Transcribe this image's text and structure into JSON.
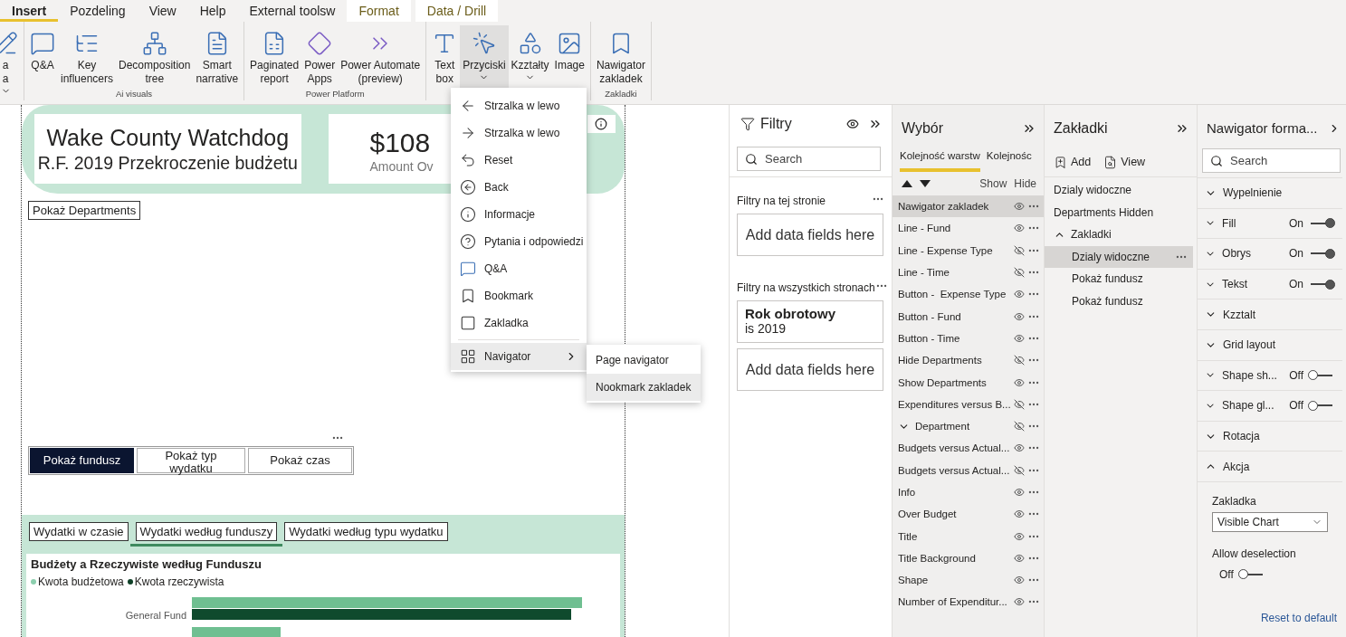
{
  "ribbon_tabs": [
    {
      "label": "Insert",
      "selected": true,
      "kind": "normal"
    },
    {
      "label": "Pozdeling",
      "selected": false,
      "kind": "normal"
    },
    {
      "label": "View",
      "selected": false,
      "kind": "normal"
    },
    {
      "label": "Help",
      "selected": false,
      "kind": "normal"
    },
    {
      "label": "External toolsw",
      "selected": false,
      "kind": "normal"
    },
    {
      "label": "Format",
      "selected": false,
      "kind": "contextual"
    },
    {
      "label": "Data / Drill",
      "selected": false,
      "kind": "contextual"
    }
  ],
  "ribbon_groups": [
    {
      "items": [
        {
          "lines": [
            "a",
            "a"
          ],
          "dropdown": true,
          "selected": false
        }
      ]
    },
    {
      "label": "Ai visuals",
      "items": [
        {
          "lines": [
            "Q&A"
          ],
          "dropdown": false,
          "selected": false
        },
        {
          "lines": [
            "Key",
            "influencers"
          ],
          "dropdown": false,
          "selected": false
        },
        {
          "lines": [
            "Decomposition",
            "tree"
          ],
          "dropdown": false,
          "selected": false
        },
        {
          "lines": [
            "Smart",
            "narrative"
          ],
          "dropdown": false,
          "selected": false
        }
      ]
    },
    {
      "label": "Power Platform",
      "items": [
        {
          "lines": [
            "Paginated",
            "report"
          ],
          "dropdown": false,
          "selected": false
        },
        {
          "lines": [
            "Power",
            "Apps"
          ],
          "dropdown": false,
          "selected": false
        },
        {
          "lines": [
            "Power Automate",
            "(preview)"
          ],
          "dropdown": false,
          "selected": false
        }
      ]
    },
    {
      "items": [
        {
          "lines": [
            "Text",
            "box"
          ],
          "dropdown": false,
          "selected": false
        },
        {
          "lines": [
            "Przyciski"
          ],
          "dropdown": true,
          "selected": true
        },
        {
          "lines": [
            "Kzztałty"
          ],
          "dropdown": true,
          "selected": false
        },
        {
          "lines": [
            "Image"
          ],
          "dropdown": false,
          "selected": false
        }
      ]
    },
    {
      "label": "Zakladki",
      "items": [
        {
          "lines": [
            "Nawigator",
            "zakladek"
          ],
          "dropdown": false,
          "selected": false
        }
      ]
    }
  ],
  "canvas": {
    "title": "Wake County Watchdog",
    "subtitle": "R.F. 2019 Przekroczenie budżetu",
    "kpi": {
      "value": "$108",
      "caption": "Amount Ov"
    },
    "show_departments": "Pokaż Departments",
    "view_buttons": [
      {
        "label": "Pokaż fundusz",
        "selected": true
      },
      {
        "label": "Pokaż typ wydatku",
        "selected": false
      },
      {
        "label": "Pokaż czas",
        "selected": false
      }
    ],
    "chart_tabs": [
      {
        "label": "Wydatki w czasie",
        "selected": false
      },
      {
        "label": "Wydatki według funduszy",
        "selected": true
      },
      {
        "label": "Wydatki według typu wydatku",
        "selected": false
      }
    ],
    "chart": {
      "title": "Budżety a Rzeczywiste według Funduszu",
      "legend": [
        {
          "label": "Kwota budżetowa",
          "color": "#8ccfae"
        },
        {
          "label": "Kwota rzeczywista",
          "color": "#0e3f27"
        }
      ],
      "category": "General Fund"
    }
  },
  "insert_menu": [
    {
      "label": "Strzalka w lewo",
      "highlighted": false
    },
    {
      "label": "Strzalka w lewo",
      "highlighted": false
    },
    {
      "label": "Reset",
      "highlighted": false
    },
    {
      "label": "Back",
      "highlighted": false
    },
    {
      "label": "Informacje",
      "highlighted": false
    },
    {
      "label": "Pytania i odpowiedzi",
      "highlighted": false
    },
    {
      "label": "Q&A",
      "highlighted": false
    },
    {
      "label": "Bookmark",
      "highlighted": false
    },
    {
      "label": "Zakladka",
      "highlighted": false
    },
    {
      "label": "Navigator",
      "highlighted": true,
      "submenu": [
        {
          "label": "Page navigator",
          "highlighted": false
        },
        {
          "label": "Nookmark zakladek",
          "highlighted": true
        }
      ]
    }
  ],
  "filters_pane": {
    "title": "Filtry",
    "search": {
      "placeholder": "Search"
    },
    "page_section": "Filtry na tej stronie",
    "page_drop": "Add data fields here",
    "all_section": "Filtry na wszystkich stronach",
    "filter_card": {
      "field": "Rok obrotowy",
      "condition": "is 2019"
    },
    "all_drop": "Add data fields here"
  },
  "selection_pane": {
    "title": "Wybór",
    "tabs": [
      {
        "label": "Kolejność warstw",
        "selected": true
      },
      {
        "label": "Kolejnośc",
        "selected": false
      }
    ],
    "show": "Show",
    "hide": "Hide",
    "layers": [
      {
        "label": "Nawigator zakladek",
        "visible": true,
        "selected": true
      },
      {
        "label": "Line - Fund",
        "visible": true,
        "selected": false
      },
      {
        "label": "Line - Expense Type",
        "visible": false,
        "selected": false
      },
      {
        "label": "Line - Time",
        "visible": false,
        "selected": false
      },
      {
        "label": "Button -  Expense Type",
        "visible": true,
        "selected": false
      },
      {
        "label": "Button - Fund",
        "visible": true,
        "selected": false
      },
      {
        "label": "Button - Time",
        "visible": true,
        "selected": false
      },
      {
        "label": "Hide Departments",
        "visible": false,
        "selected": false
      },
      {
        "label": "Show Departments",
        "visible": true,
        "selected": false
      },
      {
        "label": "Expenditures versus B...",
        "visible": false,
        "selected": false
      },
      {
        "label": "Department",
        "visible": false,
        "selected": false,
        "expanded": true
      },
      {
        "label": "Budgets versus Actual...",
        "visible": true,
        "selected": false
      },
      {
        "label": "Budgets versus Actual...",
        "visible": false,
        "selected": false
      },
      {
        "label": "Info",
        "visible": true,
        "selected": false
      },
      {
        "label": "Over Budget",
        "visible": true,
        "selected": false
      },
      {
        "label": "Title",
        "visible": true,
        "selected": false
      },
      {
        "label": "Title Background",
        "visible": true,
        "selected": false
      },
      {
        "label": "Shape",
        "visible": true,
        "selected": false
      },
      {
        "label": "Number of Expenditur...",
        "visible": true,
        "selected": false
      }
    ]
  },
  "bookmarks_pane": {
    "title": "Zakładki",
    "add": "Add",
    "view": "View",
    "items": [
      {
        "label": "Dzialy widoczne",
        "selected": false
      },
      {
        "label": "Departments Hidden",
        "selected": false
      },
      {
        "label": "Zakladki",
        "selected": false,
        "expanded": true,
        "children": [
          {
            "label": "Dzialy widoczne",
            "selected": true
          },
          {
            "label": "Pokaż fundusz",
            "selected": false
          },
          {
            "label": "Pokaż fundusz",
            "selected": false
          }
        ]
      }
    ]
  },
  "format_pane": {
    "title": "Nawigator forma...",
    "search": {
      "placeholder": "Search"
    },
    "sections": [
      {
        "label": "Wypelnienie",
        "expanded": false
      },
      {
        "label": "Fill",
        "expanded": false,
        "toggle": {
          "label": "On",
          "on": true
        }
      },
      {
        "label": "Obrys",
        "expanded": false,
        "toggle": {
          "label": "On",
          "on": true
        }
      },
      {
        "label": "Tekst",
        "expanded": false,
        "toggle": {
          "label": "On",
          "on": true
        }
      },
      {
        "label": "Kzztalt",
        "expanded": false
      },
      {
        "label": "Grid layout",
        "expanded": false
      },
      {
        "label": "Shape sh...",
        "expanded": false,
        "toggle": {
          "label": "Off",
          "on": false
        }
      },
      {
        "label": "Shape gl...",
        "expanded": false,
        "toggle": {
          "label": "Off",
          "on": false
        }
      },
      {
        "label": "Rotacja",
        "expanded": false
      },
      {
        "label": "Akcja",
        "expanded": true
      }
    ],
    "action": {
      "bookmark_label": "Zakladka",
      "bookmark_value": "Visible Chart",
      "deselect_label": "Allow deselection",
      "deselect_toggle": {
        "label": "Off",
        "on": false
      },
      "reset": "Reset to default"
    }
  }
}
